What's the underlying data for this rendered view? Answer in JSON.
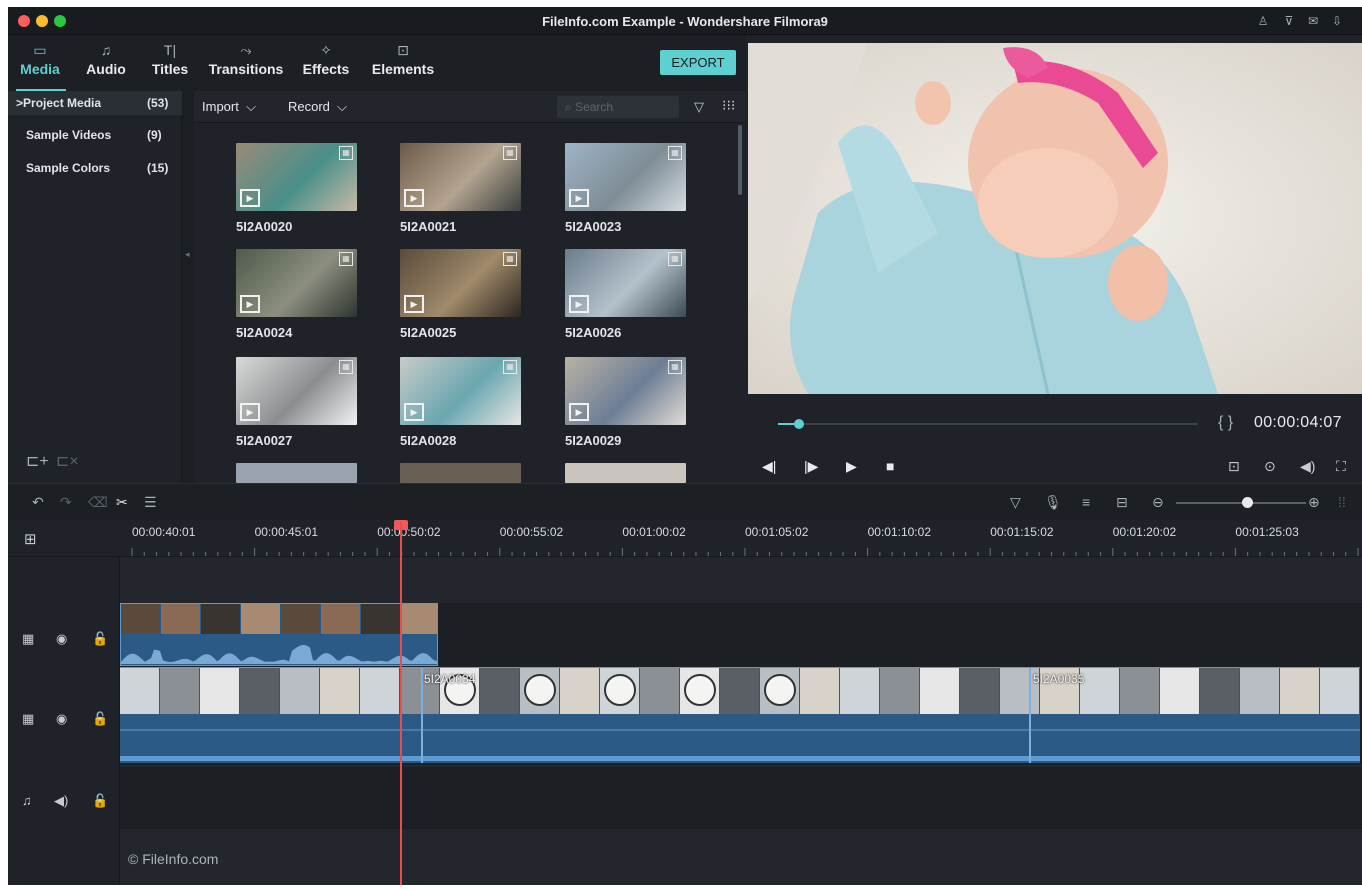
{
  "window": {
    "title": "FileInfo.com Example - Wondershare Filmora9"
  },
  "tabs": [
    {
      "label": "Media",
      "icon": "folder-icon"
    },
    {
      "label": "Audio",
      "icon": "music-note-icon"
    },
    {
      "label": "Titles",
      "icon": "text-icon"
    },
    {
      "label": "Transitions",
      "icon": "transition-icon"
    },
    {
      "label": "Effects",
      "icon": "sparkle-icon"
    },
    {
      "label": "Elements",
      "icon": "image-icon"
    }
  ],
  "export_label": "EXPORT",
  "sidebar": {
    "items": [
      {
        "name": "Project Media",
        "count": "(53)",
        "prefix": ">"
      },
      {
        "name": "Sample Videos",
        "count": "(9)"
      },
      {
        "name": "Sample Colors",
        "count": "(15)"
      }
    ]
  },
  "media_toolbar": {
    "import": "Import",
    "record": "Record",
    "search_placeholder": "Search"
  },
  "media": [
    {
      "name": "5I2A0020",
      "colors": [
        "#9a8a78",
        "#4a8f8a",
        "#c7b9a5"
      ]
    },
    {
      "name": "5I2A0021",
      "colors": [
        "#6b5a48",
        "#b3a48f",
        "#3a3f40"
      ]
    },
    {
      "name": "5I2A0023",
      "colors": [
        "#9fb4c8",
        "#7e8c95",
        "#d6dde3"
      ]
    },
    {
      "name": "5I2A0024",
      "colors": [
        "#4f5a4a",
        "#8c8f80",
        "#2e3530"
      ]
    },
    {
      "name": "5I2A0025",
      "colors": [
        "#5a4a3a",
        "#a08a6a",
        "#2c2620"
      ]
    },
    {
      "name": "5I2A0026",
      "colors": [
        "#6a7c8a",
        "#b4c2cc",
        "#3c4a55"
      ]
    },
    {
      "name": "5I2A0027",
      "colors": [
        "#d8dad8",
        "#8a8e90",
        "#f2f2f2"
      ]
    },
    {
      "name": "5I2A0028",
      "colors": [
        "#c8cbc8",
        "#6aa6b0",
        "#e6e6e4"
      ]
    },
    {
      "name": "5I2A0029",
      "colors": [
        "#b9b2a6",
        "#6d7e95",
        "#e2ddd5"
      ]
    }
  ],
  "preview": {
    "timecode": "00:00:04:07",
    "progress": 0.05
  },
  "ruler": [
    "00:00:40:01",
    "00:00:45:01",
    "00:00:50:02",
    "00:00:55:02",
    "00:01:00:02",
    "00:01:05:02",
    "00:01:10:02",
    "00:01:15:02",
    "00:01:20:02",
    "00:01:25:03"
  ],
  "clips": [
    {
      "name": "5I2A0034"
    },
    {
      "name": "5I2A0035"
    }
  ],
  "watermark": "© FileInfo.com",
  "colors": {
    "accent": "#5fd0d0",
    "playhead": "#e84d4d",
    "clip": "#2c5a86"
  }
}
